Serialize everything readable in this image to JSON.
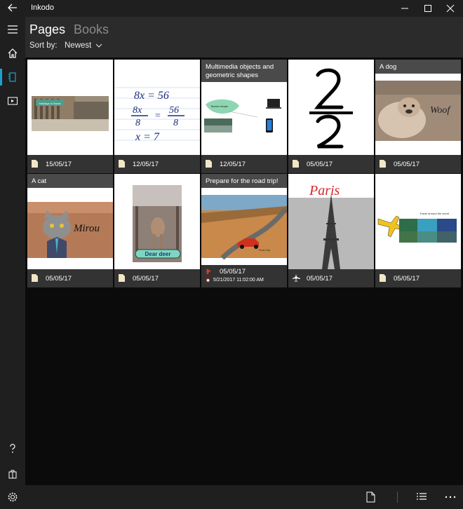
{
  "app": {
    "title": "Inkodo"
  },
  "header": {
    "tabs": [
      {
        "label": "Pages"
      },
      {
        "label": "Books"
      }
    ],
    "sort_label": "Sort by:",
    "sort_value": "Newest"
  },
  "cards": [
    {
      "title": "",
      "date": "15/05/17",
      "thumb_text": "Holidays in Rome"
    },
    {
      "title": "",
      "date": "12/05/17",
      "thumb_text": ""
    },
    {
      "title": "Multimedia objects and geometric shapes",
      "date": "12/05/17",
      "thumb_text": "Border shape"
    },
    {
      "title": "",
      "date": "05/05/17",
      "thumb_text": ""
    },
    {
      "title": "A dog",
      "date": "05/05/17",
      "thumb_text": "Woof"
    },
    {
      "title": "A cat",
      "date": "05/05/17",
      "thumb_text": "Mirou"
    },
    {
      "title": "",
      "date": "05/05/17",
      "thumb_text": "Dear deer"
    },
    {
      "title": "Prepare for the road trip!",
      "date": "05/05/17",
      "thumb_text": "Road trip",
      "reminder": "5/21/2017 11:02:00 AM"
    },
    {
      "title": "",
      "date": "05/05/17",
      "thumb_text": "Paris"
    },
    {
      "title": "",
      "date": "05/05/17",
      "thumb_text": "Travel around the world"
    }
  ],
  "colors": {
    "accent": "#1f9fd0",
    "background": "#0b0b0b",
    "chrome": "#1f1f1f"
  }
}
